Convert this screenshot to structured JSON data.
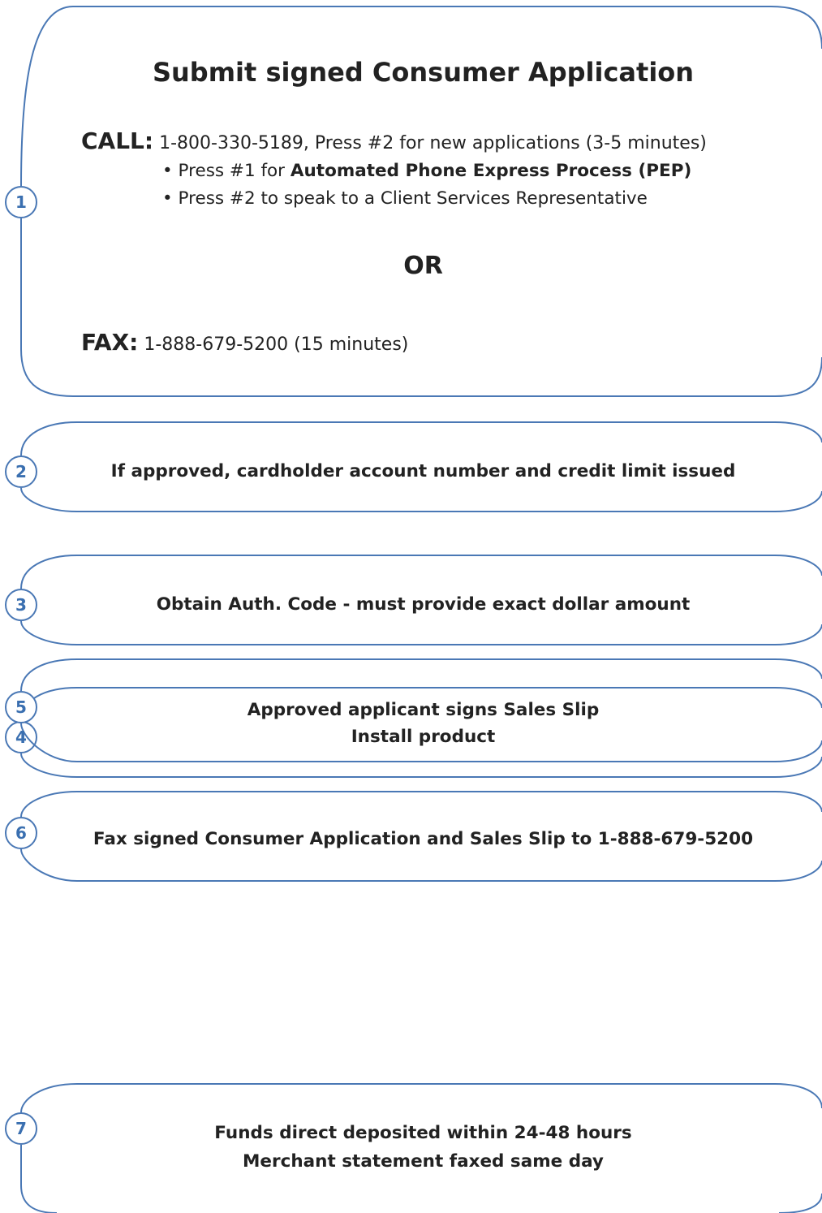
{
  "colors": {
    "frame": "#4a78b5",
    "text": "#222222"
  },
  "step1": {
    "number": "1",
    "title": "Submit signed Consumer Application",
    "call_label": "CALL:",
    "call_text": "1-800-330-5189, Press #2 for new applications (3-5 minutes)",
    "bullet1_prefix": "• Press #1 for ",
    "bullet1_bold": "Automated Phone Express Process (PEP)",
    "bullet2": "• Press #2 to speak to a Client Services Representative",
    "or": "OR",
    "fax_label": "FAX:",
    "fax_text": "1-888-679-5200 (15 minutes)"
  },
  "steps": [
    {
      "number": "2",
      "lines": [
        "If approved, cardholder account number and credit limit issued"
      ]
    },
    {
      "number": "3",
      "lines": [
        "Obtain Auth. Code - must provide exact dollar amount"
      ]
    },
    {
      "number": "4",
      "lines": [
        "Install product"
      ]
    },
    {
      "number": "5",
      "lines": [
        "Approved applicant signs Sales Slip"
      ]
    },
    {
      "number": "6",
      "lines": [
        "Fax signed Consumer Application and Sales Slip to 1-888-679-5200"
      ]
    },
    {
      "number": "7",
      "lines": [
        "Funds direct deposited within 24-48 hours",
        "Merchant statement faxed same day"
      ]
    }
  ]
}
